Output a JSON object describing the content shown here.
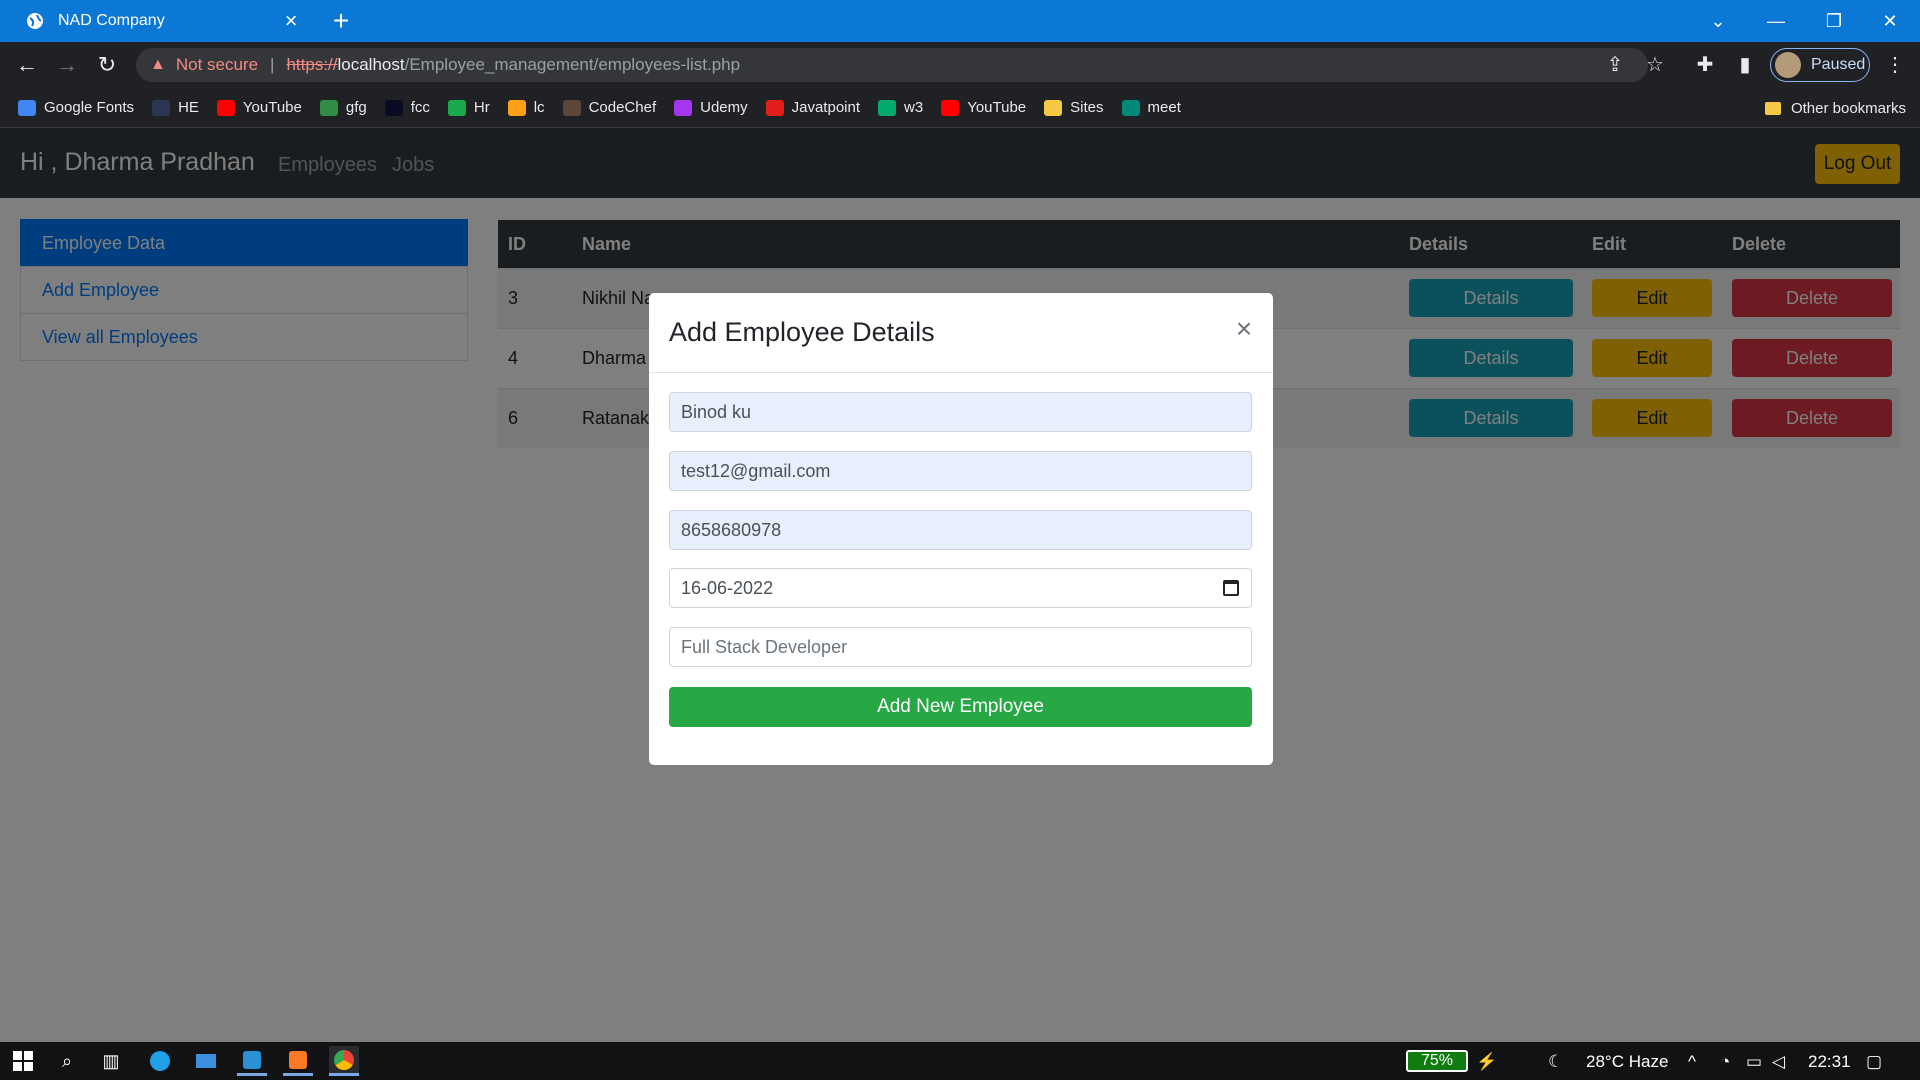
{
  "browser": {
    "tab_title": "NAD Company",
    "url_warning": "Not secure",
    "url_scheme": "https://",
    "url_host": "localhost",
    "url_path": "/Employee_management/employees-list.php",
    "profile_label": "Paused",
    "bookmarks": [
      {
        "label": "Google Fonts",
        "icon": "google-fonts-icon",
        "color": "#4285f4"
      },
      {
        "label": "HE",
        "icon": "hackerearth-icon",
        "color": "#2c3454"
      },
      {
        "label": "YouTube",
        "icon": "youtube-icon",
        "color": "#ff0000"
      },
      {
        "label": "gfg",
        "icon": "gfg-icon",
        "color": "#2f8d46"
      },
      {
        "label": "fcc",
        "icon": "freecodecamp-icon",
        "color": "#0a0a23"
      },
      {
        "label": "Hr",
        "icon": "hackerrank-icon",
        "color": "#1ba94c"
      },
      {
        "label": "lc",
        "icon": "leetcode-icon",
        "color": "#ffa116"
      },
      {
        "label": "CodeChef",
        "icon": "codechef-icon",
        "color": "#5b4638"
      },
      {
        "label": "Udemy",
        "icon": "udemy-icon",
        "color": "#a435f0"
      },
      {
        "label": "Javatpoint",
        "icon": "javatpoint-icon",
        "color": "#e11d1d"
      },
      {
        "label": "w3",
        "icon": "w3schools-icon",
        "color": "#04aa6d"
      },
      {
        "label": "YouTube",
        "icon": "youtube-icon",
        "color": "#ff0000"
      },
      {
        "label": "Sites",
        "icon": "folder-icon",
        "color": "#f6c843"
      },
      {
        "label": "meet",
        "icon": "google-meet-icon",
        "color": "#00897b"
      }
    ],
    "other_bookmarks": "Other bookmarks"
  },
  "app": {
    "brand": "Hi , Dharma Pradhan",
    "nav": [
      "Employees",
      "Jobs"
    ],
    "logout": "Log Out",
    "sidebar": [
      "Employee Data",
      "Add Employee",
      "View all Employees"
    ],
    "table": {
      "headers": {
        "id": "ID",
        "name": "Name",
        "details": "Details",
        "edit": "Edit",
        "delete": "Delete"
      },
      "rows": [
        {
          "id": "3",
          "name": "Nikhil Na"
        },
        {
          "id": "4",
          "name": "Dharma"
        },
        {
          "id": "6",
          "name": "Ratanaka"
        }
      ],
      "btn_details": "Details",
      "btn_edit": "Edit",
      "btn_delete": "Delete"
    }
  },
  "modal": {
    "title": "Add Employee Details",
    "close": "×",
    "name_value": "Binod ku",
    "email_value": "test12@gmail.com",
    "phone_value": "8658680978",
    "date_value": "16-06-2022",
    "role_placeholder": "Full Stack Developer",
    "submit": "Add New Employee"
  },
  "taskbar": {
    "battery": "75%",
    "weather": "28°C  Haze",
    "time": "22:31"
  }
}
